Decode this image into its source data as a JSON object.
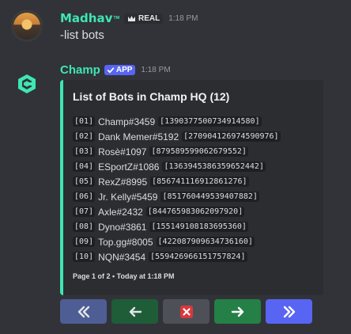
{
  "messages": [
    {
      "author": "Madhav",
      "author_sup": "ᵀᴹ",
      "tag_label": "REAL",
      "time": "1:18 PM",
      "content": "-list bots"
    },
    {
      "author": "Champ",
      "tag_label": "APP",
      "time": "1:18 PM",
      "embed": {
        "accent_color": "#3ee6b3",
        "title": "List of Bots in Champ HQ (12)",
        "rows": [
          {
            "index": "[01]",
            "name": "Champ#3459",
            "id": "[1390377500734914580]"
          },
          {
            "index": "[02]",
            "name": "Dank Memer#5192",
            "id": "[270904126974590976]"
          },
          {
            "index": "[03]",
            "name": "Rosè#1097",
            "id": "[879589599062679552]"
          },
          {
            "index": "[04]",
            "name": "ESportZ#1086",
            "id": "[1363945386359652442]"
          },
          {
            "index": "[05]",
            "name": "RexZ#8995",
            "id": "[856741116912861276]"
          },
          {
            "index": "[06]",
            "name": "Jr. Kelly#5459",
            "id": "[851760449539407882]"
          },
          {
            "index": "[07]",
            "name": "Axle#2432",
            "id": "[844765983062097920]"
          },
          {
            "index": "[08]",
            "name": "Dyno#3861",
            "id": "[155149108183695360]"
          },
          {
            "index": "[09]",
            "name": "Top.gg#8005",
            "id": "[422087909634736160]"
          },
          {
            "index": "[10]",
            "name": "NQN#3454",
            "id": "[559426966151757824]"
          }
        ],
        "footer": "Page 1 of 2 • Today at 1:18 PM"
      },
      "buttons": [
        {
          "icon": "double-chevron-left-icon",
          "color": "#4e5d94"
        },
        {
          "icon": "arrow-left-icon",
          "color": "#1f5c38"
        },
        {
          "icon": "close-icon",
          "color": "#4e5058"
        },
        {
          "icon": "arrow-right-icon",
          "color": "#248046"
        },
        {
          "icon": "double-chevron-right-icon",
          "color": "#5865f2"
        }
      ]
    }
  ]
}
